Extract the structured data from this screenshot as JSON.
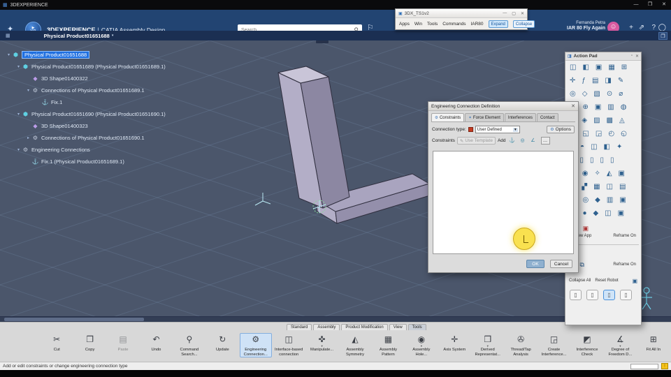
{
  "window": {
    "logo": "▦",
    "title": "3DEXPERIENCE",
    "min": "—",
    "max": "❐",
    "close": "✕"
  },
  "header": {
    "logo": "✦",
    "compass_play": "▶",
    "compass_label": "V.R",
    "brand": "3DEXPERIENCE",
    "sep": "|",
    "app": "CATIA Assembly Design",
    "search_placeholder": "Search",
    "search_icon": "⚲",
    "tag_icon": "⚐",
    "user_name": "Fernanda Petra",
    "project": "IAR 80 Fly Again",
    "avatar": "☺",
    "icons": {
      "add": "+",
      "share": "⇗",
      "help": "?",
      "power": "◯"
    }
  },
  "mini_window": {
    "icon": "▣",
    "title": "3DX_TS1v2",
    "min": "—",
    "max": "▢",
    "close": "✕",
    "menu": [
      "Apps",
      "Win",
      "Tools",
      "Commands",
      "IAR80"
    ],
    "expand": "Expand",
    "collapse": "Collapse"
  },
  "breadcrumb": {
    "grid_icon": "▦",
    "label": "Physical Product01651688",
    "caret": "▾",
    "panel_icon": "❐"
  },
  "tree": {
    "items": [
      {
        "label": "Physical Product01651688",
        "icon": "⬢",
        "expander": "▾"
      },
      {
        "label": "Physical Product01651689 (Physical Product01651689.1)",
        "icon": "⬢",
        "expander": "▾"
      },
      {
        "label": "3D Shape01400322",
        "icon": "◆",
        "expander": ""
      },
      {
        "label": "Connections of Physical Product01651689.1",
        "icon": "⚙",
        "expander": "▾"
      },
      {
        "label": "Fix.1",
        "icon": "⚓",
        "expander": ""
      },
      {
        "label": "Physical Product01651690 (Physical Product01651690.1)",
        "icon": "⬢",
        "expander": "▾"
      },
      {
        "label": "3D Shape01400323",
        "icon": "◆",
        "expander": ""
      },
      {
        "label": "Connections of Physical Product01651690.1",
        "icon": "⚙",
        "expander": "▸"
      },
      {
        "label": "Engineering Connections",
        "icon": "⚙",
        "expander": "▾"
      },
      {
        "label": "Fix.1 (Physical Product01651689.1)",
        "icon": "⚓",
        "expander": ""
      }
    ]
  },
  "dialog": {
    "title": "Engineering Connection Definition",
    "close": "✕",
    "tabs": [
      {
        "icon": "⚙",
        "label": "Constraints"
      },
      {
        "icon": "✦",
        "label": "Force Element"
      },
      {
        "icon": "",
        "label": "Interferences"
      },
      {
        "icon": "",
        "label": "Contact"
      }
    ],
    "connection_type_label": "Connection type:",
    "type_color": "#c43a20",
    "connection_type_value": "User Defined",
    "caret": "▼",
    "options_icon": "⚙",
    "options_label": "Options",
    "constraints_label": "Constraints",
    "use_template_icon": "✎",
    "use_template_label": "Use Template",
    "add_label": "Add",
    "add_icons": [
      "⚓",
      "◎",
      "∠"
    ],
    "more_label": "…",
    "ok_label": "OK",
    "cancel_label": "Cancel"
  },
  "action_pad": {
    "pin": "◨",
    "title": "Action Pad",
    "min": "▫",
    "close": "✕",
    "rows": [
      "◫◧▣▦⊞",
      "✛ƒ▤◨✎",
      "◎◇▧⊙⌀",
      "◳⊕▣▥◍",
      "⊡◈▨▩◬",
      "◰◱◲◴◵",
      "◒◓◫◧✦",
      "▯▯▯▯▯",
      "◍◉✧◭▣",
      "⇄▞▦◫▤",
      "◫◎◆▥▣",
      "▤●◆◫▣"
    ],
    "zoom_icon": "⚲",
    "pick_icon": "▣",
    "label_new_app": "in New App",
    "label_reframe": "Reframe On",
    "row13_icon1": "◫",
    "row13_icon2": "⧉",
    "label_reframe2": "Reframe On",
    "collapse_all": "Collapse All",
    "reset_robot": "Reset Robot",
    "robot_icon": "▣",
    "bottom_icons": [
      "▯",
      "▯",
      "▯",
      "▯"
    ]
  },
  "ribbon": {
    "tabs": [
      "Standard",
      "Assembly",
      "Product Modification",
      "View",
      "Tools"
    ],
    "tools": [
      {
        "glyph": "✂",
        "label": "Cut"
      },
      {
        "glyph": "❐",
        "label": "Copy"
      },
      {
        "glyph": "▤",
        "label": "Paste"
      },
      {
        "glyph": "↶",
        "label": "Undo"
      },
      {
        "glyph": "⚲",
        "label": "Command Search..."
      },
      {
        "glyph": "↻",
        "label": "Update"
      },
      {
        "glyph": "⚙",
        "label": "Engineering Connection..."
      },
      {
        "glyph": "◫",
        "label": "Interface-based connection"
      },
      {
        "glyph": "✜",
        "label": "Manipulate...",
        "caret": "▾"
      },
      {
        "glyph": "◭",
        "label": "Assembly Symmetry"
      },
      {
        "glyph": "▦",
        "label": "Assembly Pattern"
      },
      {
        "glyph": "◉",
        "label": "Assembly Hole...",
        "caret": "▾"
      },
      {
        "glyph": "✛",
        "label": "Axis System"
      },
      {
        "glyph": "❒",
        "label": "Derived Representat...",
        "caret": "▾"
      },
      {
        "glyph": "✇",
        "label": "Thread/Tap Analysis"
      },
      {
        "glyph": "◲",
        "label": "Create Interference..."
      },
      {
        "glyph": "◩",
        "label": "Interference Check"
      },
      {
        "glyph": "∡",
        "label": "Degree of Freedom D...",
        "caret": "▾"
      },
      {
        "glyph": "⊞",
        "label": "Fit All In"
      }
    ]
  },
  "status": {
    "message": "Add or edit constraints or change engineering connection type",
    "alert": "!"
  }
}
